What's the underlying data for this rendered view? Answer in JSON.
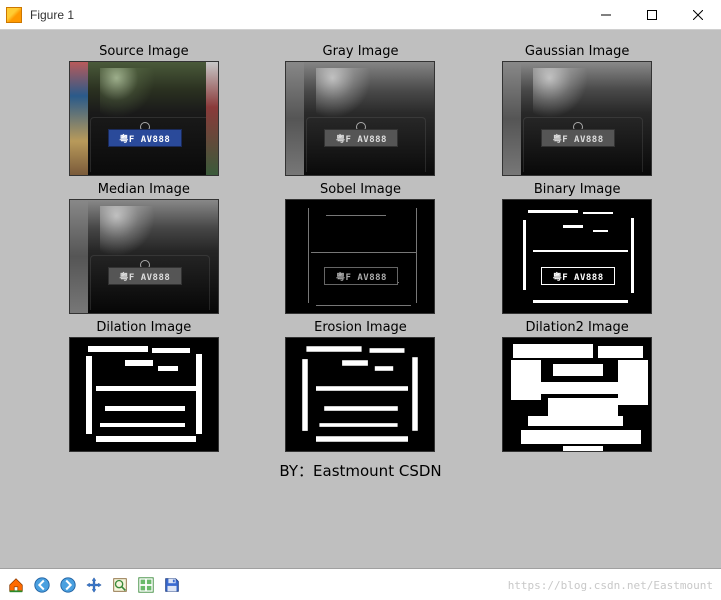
{
  "window": {
    "title": "Figure 1"
  },
  "subplots": [
    {
      "label": "Source Image",
      "plate": "粤F AV888"
    },
    {
      "label": "Gray Image",
      "plate": "粤F AV888"
    },
    {
      "label": "Gaussian Image",
      "plate": "粤F AV888"
    },
    {
      "label": "Median Image",
      "plate": "粤F AV888"
    },
    {
      "label": "Sobel Image",
      "plate": "粤F AV888"
    },
    {
      "label": "Binary Image",
      "plate": "粤F AV888"
    },
    {
      "label": "Dilation Image",
      "plate": ""
    },
    {
      "label": "Erosion Image",
      "plate": ""
    },
    {
      "label": "Dilation2 Image",
      "plate": ""
    }
  ],
  "caption": "BY：Eastmount CSDN",
  "toolbar": {
    "home": "home-icon",
    "back": "back-icon",
    "forward": "forward-icon",
    "pan": "pan-icon",
    "zoom": "zoom-icon",
    "subplots": "subplots-icon",
    "save": "save-icon"
  },
  "watermark": "https://blog.csdn.net/Eastmount"
}
